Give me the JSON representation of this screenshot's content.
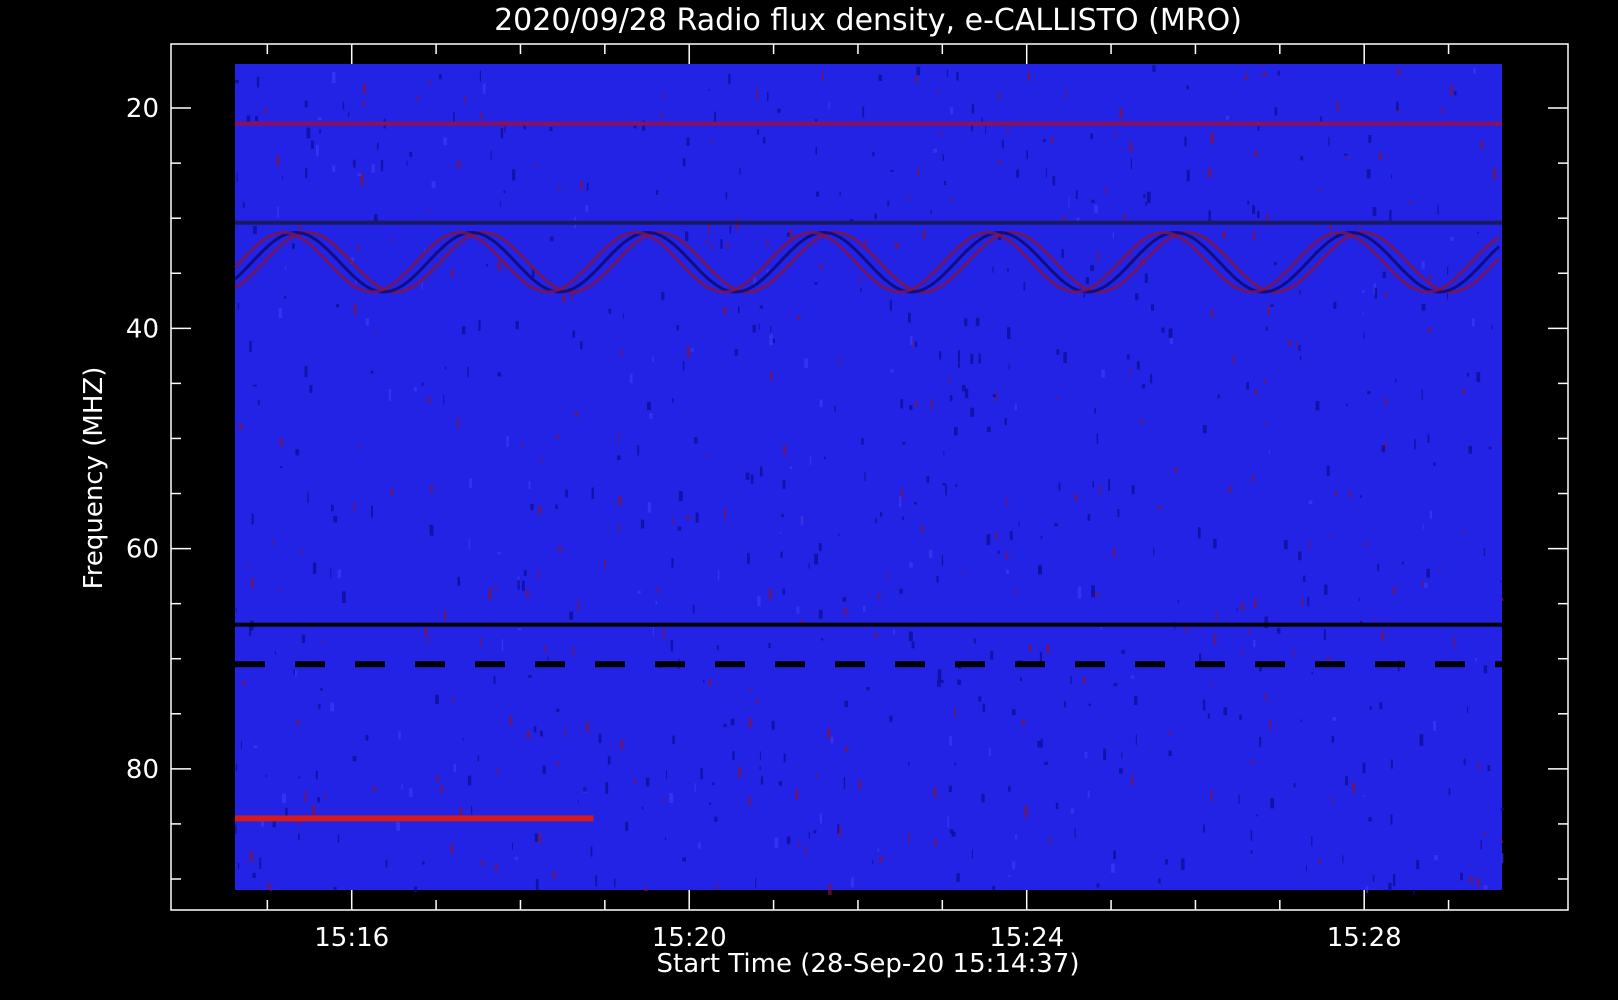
{
  "chart_data": {
    "type": "heatmap",
    "title": "2020/09/28  Radio flux density, e-CALLISTO (MRO)",
    "xlabel": "Start Time (28-Sep-20 15:14:37)",
    "ylabel": "Frequency (MHZ)",
    "x_unit": "time (HH:MM)",
    "xlim": [
      "15:14:37",
      "15:29:38"
    ],
    "ylim": [
      91.0,
      16.0
    ],
    "y_inverted": true,
    "x_ticks": [
      "15:16",
      "15:20",
      "15:24",
      "15:28"
    ],
    "y_ticks": [
      20,
      40,
      60,
      80
    ],
    "colormap": [
      "#000000",
      "#0a0aa0",
      "#2222ee",
      "#8a1060",
      "#d41a1a",
      "#ff8a2a"
    ],
    "features": [
      {
        "kind": "interference band",
        "freq_mhz": 21.5,
        "color": "#8a1060"
      },
      {
        "kind": "interference band",
        "freq_mhz": 30.5,
        "color": "#1a1a60"
      },
      {
        "kind": "wavy modulation",
        "freq_range_mhz": [
          31,
          37
        ]
      },
      {
        "kind": "strong band (early segment)",
        "freq_mhz": 84.5,
        "time_range": [
          "15:14:37",
          "15:18:52"
        ],
        "color": "#d41a1a"
      },
      {
        "kind": "dark band",
        "freq_mhz": 67.0,
        "time_range": [
          "15:14:37",
          "15:29:38"
        ]
      },
      {
        "kind": "dashed dark band",
        "freq_mhz": 70.5,
        "time_range": [
          "15:14:37",
          "15:29:38"
        ]
      }
    ]
  }
}
